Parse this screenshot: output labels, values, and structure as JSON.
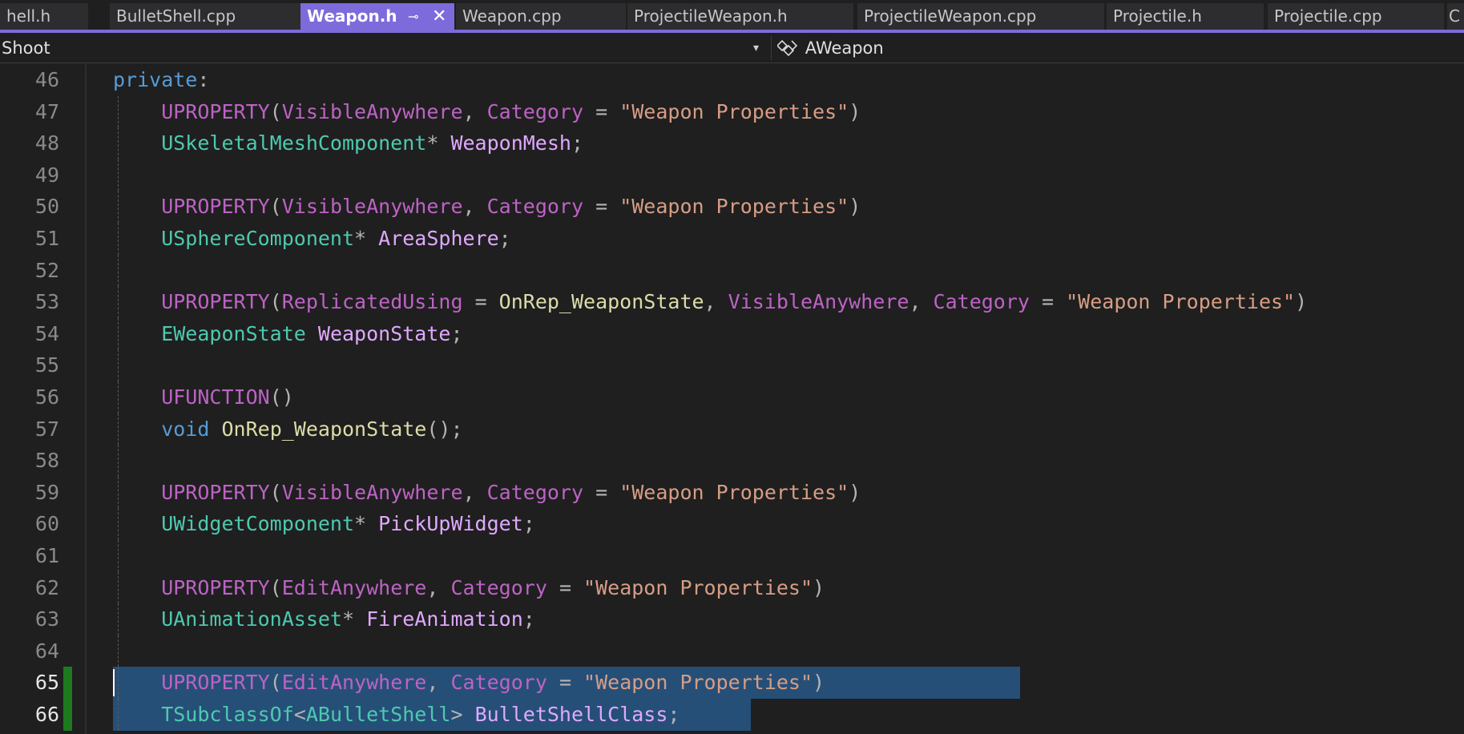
{
  "tabs": [
    {
      "label": "hell.h",
      "active": false
    },
    {
      "label": "BulletShell.cpp",
      "active": false
    },
    {
      "label": "Weapon.h",
      "active": true
    },
    {
      "label": "Weapon.cpp",
      "active": false
    },
    {
      "label": "ProjectileWeapon.h",
      "active": false
    },
    {
      "label": "ProjectileWeapon.cpp",
      "active": false
    },
    {
      "label": "Projectile.h",
      "active": false
    },
    {
      "label": "Projectile.cpp",
      "active": false
    },
    {
      "label": "C",
      "active": false
    }
  ],
  "tab_icons": {
    "pin": "⊸",
    "close": "✕"
  },
  "navbar": {
    "project": "Shoot",
    "dropdown_glyph": "▾",
    "class_icon": "class-icon",
    "class_name": "AWeapon"
  },
  "colors": {
    "accent": "#7d6bdb",
    "selection": "#264f78",
    "change_bar": "#1e7a1e",
    "background": "#1f1f1f"
  },
  "editor": {
    "lines": [
      {
        "num": "46",
        "tokens": [
          [
            "k-blue",
            "private"
          ],
          [
            "k-punc",
            ":"
          ]
        ]
      },
      {
        "num": "47",
        "tokens": [
          [
            "k-macro2",
            "    UPROPERTY"
          ],
          [
            "k-punc",
            "("
          ],
          [
            "k-macro2",
            "VisibleAnywhere"
          ],
          [
            "k-punc",
            ", "
          ],
          [
            "k-macro2",
            "Category"
          ],
          [
            "k-punc",
            " = "
          ],
          [
            "k-str",
            "\"Weapon Properties\""
          ],
          [
            "k-punc",
            ")"
          ]
        ]
      },
      {
        "num": "48",
        "tokens": [
          [
            "k-type",
            "    USkeletalMeshComponent"
          ],
          [
            "k-punc",
            "* "
          ],
          [
            "k-mem",
            "WeaponMesh"
          ],
          [
            "k-punc",
            ";"
          ]
        ]
      },
      {
        "num": "49",
        "tokens": []
      },
      {
        "num": "50",
        "tokens": [
          [
            "k-macro2",
            "    UPROPERTY"
          ],
          [
            "k-punc",
            "("
          ],
          [
            "k-macro2",
            "VisibleAnywhere"
          ],
          [
            "k-punc",
            ", "
          ],
          [
            "k-macro2",
            "Category"
          ],
          [
            "k-punc",
            " = "
          ],
          [
            "k-str",
            "\"Weapon Properties\""
          ],
          [
            "k-punc",
            ")"
          ]
        ]
      },
      {
        "num": "51",
        "tokens": [
          [
            "k-type",
            "    USphereComponent"
          ],
          [
            "k-punc",
            "* "
          ],
          [
            "k-mem",
            "AreaSphere"
          ],
          [
            "k-punc",
            ";"
          ]
        ]
      },
      {
        "num": "52",
        "tokens": []
      },
      {
        "num": "53",
        "tokens": [
          [
            "k-macro2",
            "    UPROPERTY"
          ],
          [
            "k-punc",
            "("
          ],
          [
            "k-macro2",
            "ReplicatedUsing"
          ],
          [
            "k-punc",
            " = "
          ],
          [
            "k-fn",
            "OnRep_WeaponState"
          ],
          [
            "k-punc",
            ", "
          ],
          [
            "k-macro2",
            "VisibleAnywhere"
          ],
          [
            "k-punc",
            ", "
          ],
          [
            "k-macro2",
            "Category"
          ],
          [
            "k-punc",
            " = "
          ],
          [
            "k-str",
            "\"Weapon Properties\""
          ],
          [
            "k-punc",
            ")"
          ]
        ]
      },
      {
        "num": "54",
        "tokens": [
          [
            "k-type",
            "    EWeaponState"
          ],
          [
            "k-punc",
            " "
          ],
          [
            "k-mem",
            "WeaponState"
          ],
          [
            "k-punc",
            ";"
          ]
        ]
      },
      {
        "num": "55",
        "tokens": []
      },
      {
        "num": "56",
        "tokens": [
          [
            "k-macro2",
            "    UFUNCTION"
          ],
          [
            "k-punc",
            "()"
          ]
        ]
      },
      {
        "num": "57",
        "tokens": [
          [
            "k-blue",
            "    void"
          ],
          [
            "k-punc",
            " "
          ],
          [
            "k-fn",
            "OnRep_WeaponState"
          ],
          [
            "k-punc",
            "();"
          ]
        ]
      },
      {
        "num": "58",
        "tokens": []
      },
      {
        "num": "59",
        "tokens": [
          [
            "k-macro2",
            "    UPROPERTY"
          ],
          [
            "k-punc",
            "("
          ],
          [
            "k-macro2",
            "VisibleAnywhere"
          ],
          [
            "k-punc",
            ", "
          ],
          [
            "k-macro2",
            "Category"
          ],
          [
            "k-punc",
            " = "
          ],
          [
            "k-str",
            "\"Weapon Properties\""
          ],
          [
            "k-punc",
            ")"
          ]
        ]
      },
      {
        "num": "60",
        "tokens": [
          [
            "k-type",
            "    UWidgetComponent"
          ],
          [
            "k-punc",
            "* "
          ],
          [
            "k-mem",
            "PickUpWidget"
          ],
          [
            "k-punc",
            ";"
          ]
        ]
      },
      {
        "num": "61",
        "tokens": []
      },
      {
        "num": "62",
        "tokens": [
          [
            "k-macro2",
            "    UPROPERTY"
          ],
          [
            "k-punc",
            "("
          ],
          [
            "k-macro2",
            "EditAnywhere"
          ],
          [
            "k-punc",
            ", "
          ],
          [
            "k-macro2",
            "Category"
          ],
          [
            "k-punc",
            " = "
          ],
          [
            "k-str",
            "\"Weapon Properties\""
          ],
          [
            "k-punc",
            ")"
          ]
        ]
      },
      {
        "num": "63",
        "tokens": [
          [
            "k-type",
            "    UAnimationAsset"
          ],
          [
            "k-punc",
            "* "
          ],
          [
            "k-mem",
            "FireAnimation"
          ],
          [
            "k-punc",
            ";"
          ]
        ]
      },
      {
        "num": "64",
        "tokens": []
      },
      {
        "num": "65",
        "tokens": [
          [
            "k-macro2",
            "    UPROPERTY"
          ],
          [
            "k-punc",
            "("
          ],
          [
            "k-macro2",
            "EditAnywhere"
          ],
          [
            "k-punc",
            ", "
          ],
          [
            "k-macro2",
            "Category"
          ],
          [
            "k-punc",
            " = "
          ],
          [
            "k-str",
            "\"Weapon Properties\""
          ],
          [
            "k-punc",
            ")"
          ]
        ]
      },
      {
        "num": "66",
        "tokens": [
          [
            "k-type",
            "    TSubclassOf"
          ],
          [
            "k-punc",
            "<"
          ],
          [
            "k-type",
            "ABulletShell"
          ],
          [
            "k-punc",
            "> "
          ],
          [
            "k-mem",
            "BulletShellClass"
          ],
          [
            "k-punc",
            ";"
          ]
        ]
      }
    ]
  }
}
